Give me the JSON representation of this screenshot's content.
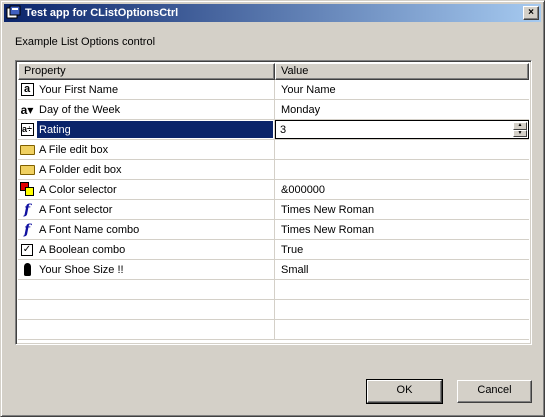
{
  "window": {
    "title": "Test app for CListOptionsCtrl",
    "close_label": "×"
  },
  "description": "Example List Options control",
  "columns": {
    "property": "Property",
    "value": "Value"
  },
  "rows": [
    {
      "icon": "text-edit-icon",
      "label": "Your First Name",
      "value": "Your Name"
    },
    {
      "icon": "text-combo-icon",
      "label": "Day of the Week",
      "value": "Monday"
    },
    {
      "icon": "spin-edit-icon",
      "label": "Rating",
      "value": "3",
      "selected": true
    },
    {
      "icon": "folder-open-icon",
      "label": "A File edit box",
      "value": ""
    },
    {
      "icon": "folder-open-icon",
      "label": "A Folder edit box",
      "value": ""
    },
    {
      "icon": "color-icon",
      "label": "A Color selector",
      "value": "&000000"
    },
    {
      "icon": "font-icon",
      "label": "A Font selector",
      "value": "Times New Roman"
    },
    {
      "icon": "font-icon",
      "label": "A Font Name combo",
      "value": "Times New Roman"
    },
    {
      "icon": "checkbox-icon",
      "label": "A Boolean combo",
      "value": "True"
    },
    {
      "icon": "shoe-icon",
      "label": "Your Shoe Size !!",
      "value": "Small"
    }
  ],
  "buttons": {
    "ok": "OK",
    "cancel": "Cancel"
  },
  "colors": {
    "title_start": "#0a246a",
    "title_end": "#a6caf0",
    "selection": "#0a246a",
    "face": "#d4d0c8"
  }
}
